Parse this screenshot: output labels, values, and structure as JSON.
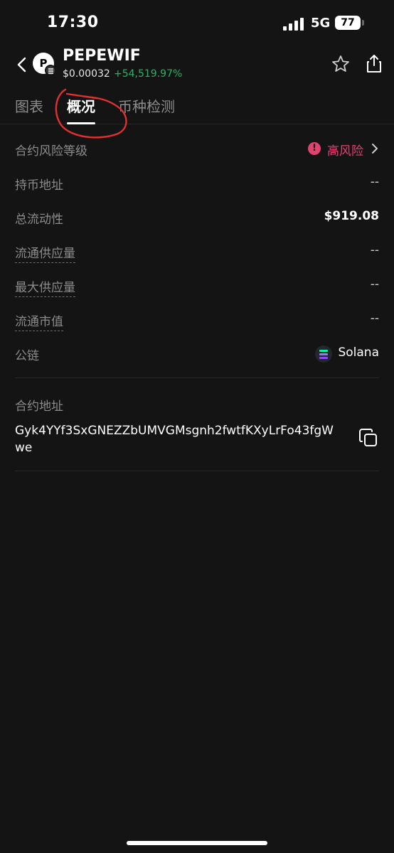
{
  "status_bar": {
    "time": "17:30",
    "network": "5G",
    "battery": "77"
  },
  "header": {
    "title": "PEPEWIF",
    "avatar_letter": "P",
    "price": "$0.00032",
    "change": "+54,519.97%"
  },
  "tabs": [
    {
      "label": "图表",
      "active": false
    },
    {
      "label": "概况",
      "active": true
    },
    {
      "label": "币种检测",
      "active": false
    }
  ],
  "overview": {
    "risk": {
      "label": "合约风险等级",
      "value": "高风险",
      "icon": "!"
    },
    "holders": {
      "label": "持币地址",
      "value": "--"
    },
    "liquidity": {
      "label": "总流动性",
      "value": "$919.08"
    },
    "circulating_supply": {
      "label": "流通供应量",
      "value": "--"
    },
    "max_supply": {
      "label": "最大供应量",
      "value": "--"
    },
    "market_cap": {
      "label": "流通市值",
      "value": "--"
    },
    "chain": {
      "label": "公链",
      "value": "Solana"
    }
  },
  "contract": {
    "label": "合约地址",
    "address": "Gyk4YYf3SxGNEZZbUMVGMsgnh2fwtfKXyLrFo43fgWwe"
  },
  "colors": {
    "background": "#141414",
    "positive": "#28b463",
    "risk": "#e0436e",
    "annotation": "#e23030"
  }
}
